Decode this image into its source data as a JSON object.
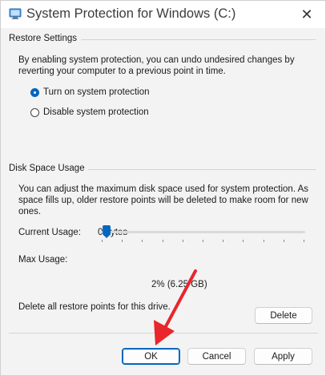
{
  "window": {
    "title": "System Protection for Windows (C:)",
    "close_glyph": "✕"
  },
  "restore_settings": {
    "group_title": "Restore Settings",
    "description": "By enabling system protection, you can undo undesired changes by reverting your computer to a previous point in time.",
    "options": [
      {
        "label": "Turn on system protection",
        "selected": true
      },
      {
        "label": "Disable system protection",
        "selected": false
      }
    ]
  },
  "disk_space": {
    "group_title": "Disk Space Usage",
    "description": "You can adjust the maximum disk space used for system protection. As space fills up, older restore points will be deleted to make room for new ones.",
    "current_usage_label": "Current Usage:",
    "current_usage_value": "0 bytes",
    "max_usage_label": "Max Usage:",
    "max_usage_value": "2% (6.25 GB)",
    "max_usage_percent": 2,
    "delete_text": "Delete all restore points for this drive.",
    "delete_label": "Delete"
  },
  "footer": {
    "ok_label": "OK",
    "cancel_label": "Cancel",
    "apply_label": "Apply"
  },
  "colors": {
    "accent": "#0067c0",
    "annotation_arrow": "#e8262b"
  }
}
